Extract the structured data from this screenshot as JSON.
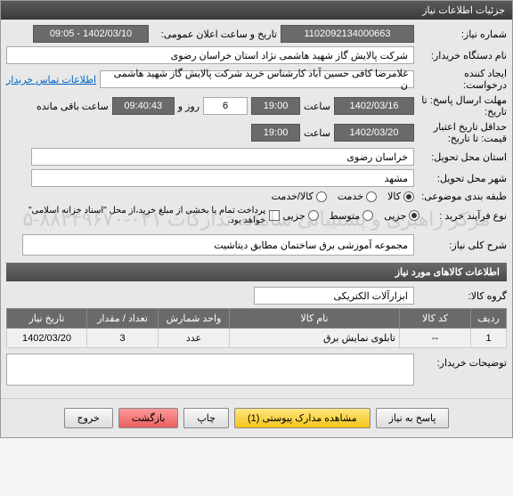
{
  "title": "جزئیات اطلاعات نیاز",
  "fields": {
    "need_no_label": "شماره نیاز:",
    "need_no": "1102092134000663",
    "announce_label": "تاریخ و ساعت اعلان عمومی:",
    "announce": "1402/03/10 - 09:05",
    "buyer_label": "نام دستگاه خریدار:",
    "buyer": "شرکت پالایش گاز شهید هاشمی نژاد   استان خراسان رضوی",
    "requester_label": "ایجاد کننده درخواست:",
    "requester": "غلامرضا کافی حسین آباد کارشناس خرید  شرکت پالایش گاز شهید هاشمی ن",
    "contact_link": "اطلاعات تماس خریدار",
    "deadline_label": "مهلت ارسال پاسخ: تا تاریخ:",
    "deadline_date": "1402/03/16",
    "time_label": "ساعت",
    "deadline_time": "19:00",
    "days": "6",
    "days_label": "روز و",
    "countdown": "09:40:43",
    "remaining": "ساعت باقی مانده",
    "validity_label": "حداقل تاریخ اعتبار قیمت: تا تاریخ:",
    "validity_date": "1402/03/20",
    "validity_time": "19:00",
    "province_label": "استان محل تحویل:",
    "province": "خراسان رضوی",
    "city_label": "شهر محل تحویل:",
    "city": "مشهد",
    "category_label": "طبقه بندی موضوعی:",
    "cat_goods": "کالا",
    "cat_service": "خدمت",
    "cat_both": "کالا/خدمت",
    "process_label": "نوع فرآیند خرید :",
    "proc_minor": "جزیی",
    "proc_medium": "متوسط",
    "proc_major": "جزیی",
    "payment_note": "پرداخت تمام یا بخشی از مبلغ خرید،از محل \"اسناد خزانه اسلامی\" خواهد بود.",
    "desc_label": "شرح کلی نیاز:",
    "desc": "مجموعه آموزشی برق ساختمان مطابق دیتاشیت",
    "items_section": "اطلاعات کالاهای مورد نیاز",
    "group_label": "گروه کالا:",
    "group": "ابزارآلات الکتریکی",
    "remarks_label": "توضیحات خریدار:"
  },
  "table": {
    "headers": [
      "ردیف",
      "کد کالا",
      "نام کالا",
      "واحد شمارش",
      "تعداد / مقدار",
      "تاریخ نیاز"
    ],
    "row": [
      "1",
      "--",
      "تابلوی نمایش برق",
      "عدد",
      "3",
      "1402/03/20"
    ]
  },
  "buttons": {
    "respond": "پاسخ به نیاز",
    "attachments": "مشاهده مدارک پیوستی (1)",
    "print": "چاپ",
    "back": "بازگشت",
    "exit": "خروج"
  },
  "watermark": "مرکز راهبری و پشتیبانی سامانه تدارکات\n۰۲۱-۸۸۳۴۹۶۷۰-۵"
}
